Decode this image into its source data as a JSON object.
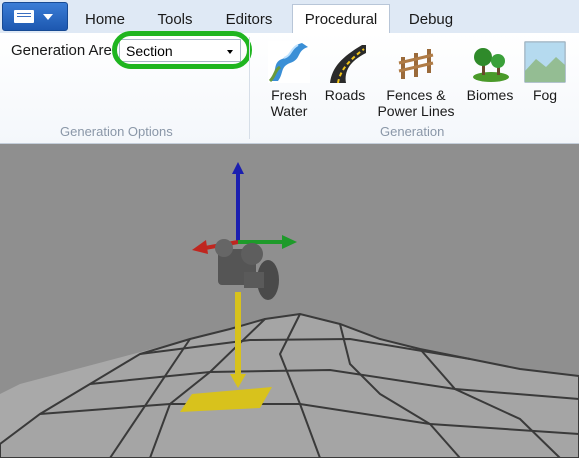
{
  "tabs": [
    {
      "label": "Home"
    },
    {
      "label": "Tools"
    },
    {
      "label": "Editors"
    },
    {
      "label": "Procedural",
      "active": true
    },
    {
      "label": "Debug"
    }
  ],
  "generation_options": {
    "field_label": "Generation Are",
    "selected_value": "Section",
    "group_label": "Generation Options"
  },
  "generation": {
    "group_label": "Generation",
    "buttons": [
      {
        "line1": "Fresh",
        "line2": "Water",
        "icon": "fresh-water-icon"
      },
      {
        "line1": "Roads",
        "line2": "",
        "icon": "roads-icon"
      },
      {
        "line1": "Fences &",
        "line2": "Power Lines",
        "icon": "fences-icon"
      },
      {
        "line1": "Biomes",
        "line2": "",
        "icon": "biomes-icon"
      },
      {
        "line1": "Fog",
        "line2": "",
        "icon": "fog-icon"
      }
    ]
  },
  "colors": {
    "highlight_ring": "#1fb520",
    "axis_x": "#c0261f",
    "axis_y": "#1e9a2a",
    "axis_z": "#1b1fb0",
    "yellow": "#d8c21c"
  }
}
